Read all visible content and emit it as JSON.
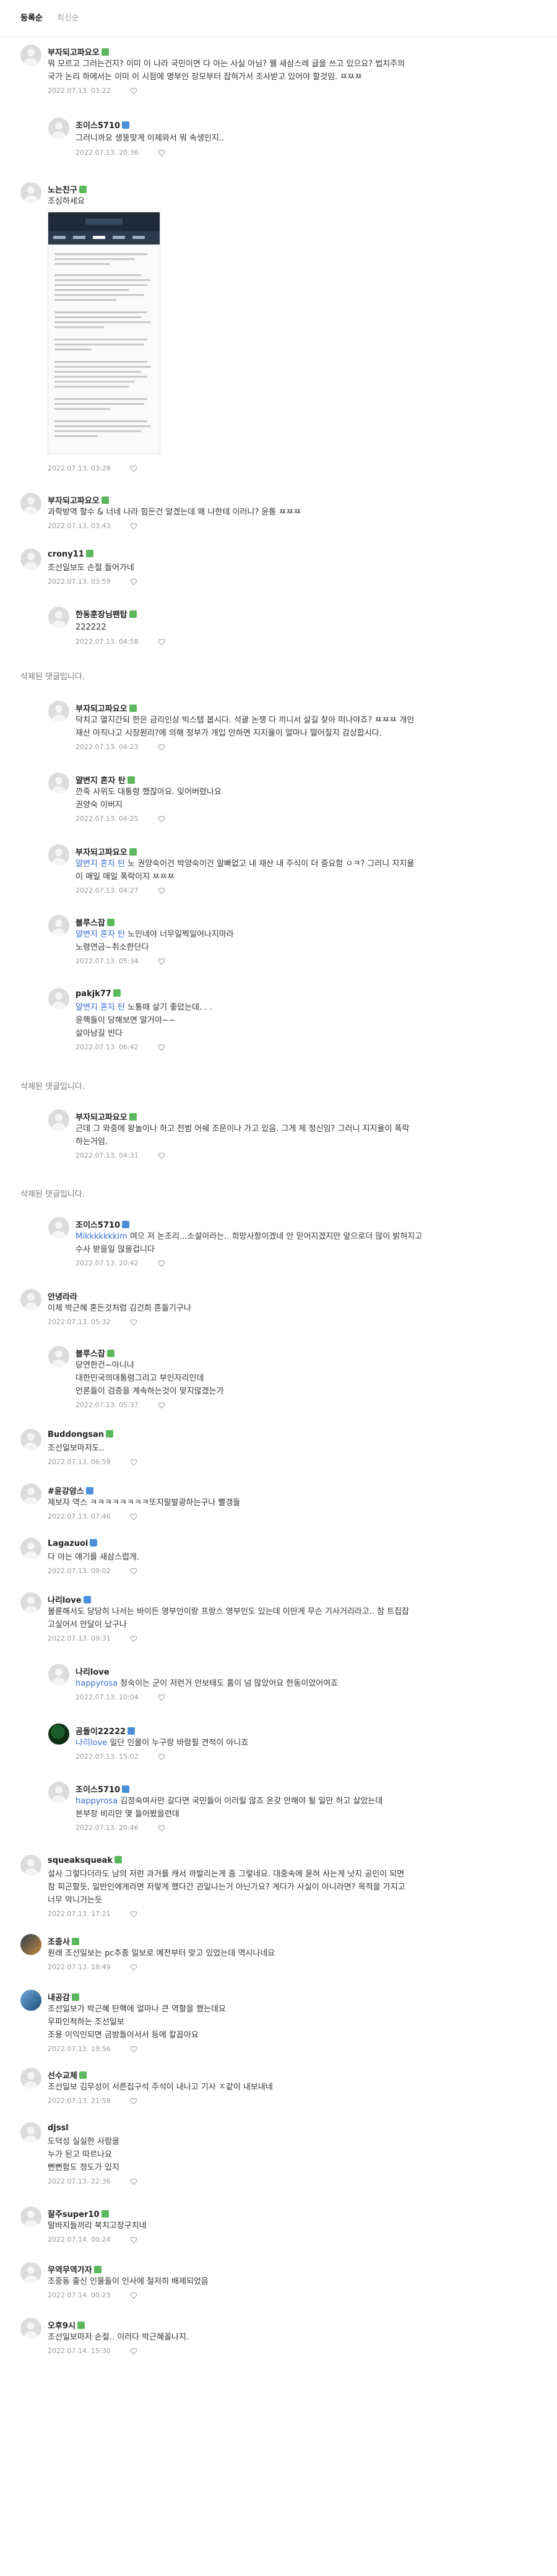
{
  "sort": {
    "active": "등록순",
    "other": "최신순"
  },
  "deleted_text": "삭제된 댓글입니다.",
  "comments": [
    {
      "nick": "부자되고파요오",
      "badge": "g",
      "text": [
        "뭐 모르고 그러는건지? 이미 이 나라 국민이면 다 아는 사실 아님? 웰 새삼스레 글을 쓰고 있으요? 법치주의",
        "국가 논리 하에서는 이미 이 시점에 명부인 장모부터 잡혀가서 조사받고 있어야 할것임. ㅉㅉㅉ"
      ],
      "date": "2022.07.13. 03:22"
    },
    {
      "nick": "조이스5710",
      "badge": "b",
      "text": [
        "그러니까요 생뚱맞게 이제와서 뭐 속생인지.."
      ],
      "date": "2022.07.13. 20:36"
    },
    {
      "nick": "노는친구",
      "badge": "g",
      "text": [
        "조심하세요"
      ],
      "date": "2022.07.13. 03:29"
    },
    {
      "nick": "부자되고파요오",
      "badge": "g",
      "text": [
        "과학방역 할수 & 너네 나라 힘든건 알겠는데 왜 나한테 이러니? 윤통 ㅉㅉㅉ"
      ],
      "date": "2022.07.13. 03:43"
    },
    {
      "nick": "crony11",
      "badge": "g",
      "text": [
        "조선일보도 손절 들어가네"
      ],
      "date": "2022.07.13. 03:59"
    },
    {
      "nick": "한동훈장님팬탑",
      "badge": "g",
      "text": [
        "222222"
      ],
      "date": "2022.07.13. 04:58"
    },
    {
      "nick": "부자되고파요오",
      "badge": "g",
      "text": [
        "닥치고 열지간되 한은 금리인상 빅스텝 봅시다. 석괄 논쟁 다 끼니서 살길 찾아 떠나야죠? ㅉㅉㅉ 개인",
        "재산 아직나고 시장원리?에 의해 정부가 개입 안하면 지지율이 얼마나 떨어질지 감상합시다."
      ],
      "date": "2022.07.13. 04:23"
    },
    {
      "nick": "얄변지 혼자 탄",
      "badge": "g",
      "text": [
        "깐죽 사위도 대통령 했잖아요. 잊어버렸나요",
        "권양숙 이버지"
      ],
      "date": "2022.07.13. 04:25"
    },
    {
      "nick": "부자되고파요오",
      "badge": "g",
      "mention": "얄변지 혼자 탄",
      "text": [
        "노 권양숙이건 박양숙이건 알빠없고 내 재산 내 주식이 더 중요함 ㅇㅋ? 그러니 지지율",
        "이 매일 매일 폭락이지 ㅉㅉㅉ"
      ],
      "date": "2022.07.13. 04:27"
    },
    {
      "nick": "블루스잡",
      "badge": "g",
      "mention": "얄변지 혼자 탄",
      "text": [
        "노인네야 너무일찍일어나지마라",
        "노령연금~취소한단다"
      ],
      "date": "2022.07.13. 05:34"
    },
    {
      "nick": "pakjk77",
      "badge": "g",
      "mention": "얄변지 혼자 탄",
      "text": [
        "노통때 살기 좋았는데. . .",
        "윤핵들이 당해보면 알거야~~",
        "살아남길 빈다"
      ],
      "date": "2022.07.13. 06:42"
    },
    {
      "nick": "부자되고파요오",
      "badge": "g",
      "text": [
        "근데 그 와중에 왕놀이나 하고 전범 어쉐 조문이나 가고 있음. 그게 제 정신임? 그러니 지지율이 폭락",
        "하는거임."
      ],
      "date": "2022.07.13. 04:31"
    },
    {
      "nick": "조이스5710",
      "badge": "b",
      "mention": "Mikkkkkkkim",
      "text": [
        "여으 저 논조리...소설이라는.. 희망사항이겠네 안 믿어지겠지만 앞으로더 많이 밝혀지고",
        "수사 받을일 많을겁니다"
      ],
      "date": "2022.07.13. 20:42"
    },
    {
      "nick": "안녕라라",
      "badge": "",
      "text": [
        "이제 박근혜 혼든것처럼 김건희 흔들기구나"
      ],
      "date": "2022.07.13. 05:32"
    },
    {
      "nick": "블루스잡",
      "badge": "g",
      "text": [
        "당연한건~아니냐",
        "대한민국의대통령그리고 부인자리인데",
        "언론들이 검증을 계속하는것이 맞지않겠는가"
      ],
      "date": "2022.07.13. 05:37"
    },
    {
      "nick": "Buddongsan",
      "badge": "g",
      "text": [
        "조선일보마저도.."
      ],
      "date": "2022.07.13. 06:59"
    },
    {
      "nick": "#윤강암스",
      "badge": "b",
      "text": [
        "제보자 역스 ㅋㅋㅋㅋㅋㅋㅋㅋ또지랄발광하는구나 빨갱들"
      ],
      "date": "2022.07.13. 07:46"
    },
    {
      "nick": "Lagazuoi",
      "badge": "b",
      "text": [
        "다 아는 얘기를 새삼스럽게."
      ],
      "date": "2022.07.13. 09:02"
    },
    {
      "nick": "나리love",
      "badge": "b",
      "text": [
        "불륜해서도 당당히 나서는 바이든 영부인이랑 프랑스 영부인도 있는데 이딴게 무슨 기사거리라고.. 참 트집잡",
        "고싶어서 안달이 났구나"
      ],
      "date": "2022.07.13. 09:31"
    },
    {
      "nick": "나리love",
      "badge": "",
      "mention": "happyrosa",
      "text": [
        "청숙이는 군이 저런거 안보태도 홈이 넘 많았어요 한동이었어여죠"
      ],
      "date": "2022.07.13. 10:04"
    },
    {
      "nick": "곰돌이22222",
      "badge": "b",
      "mention": "나리love",
      "text": [
        "일단 인물이 누구랑 바람필 견적이 아니죠"
      ],
      "date": "2022.07.13. 15:02"
    },
    {
      "nick": "조이스5710",
      "badge": "b",
      "mention": "happyrosa",
      "text": [
        "김정숙여사만 갈다면 국민들이 이러릴 않죠 온갖 안해야 될 일만 하고 살았는데",
        "본부장 비리만 몇 들어봤을련데"
      ],
      "date": "2022.07.13. 20:46"
    },
    {
      "nick": "squeaksqueak",
      "badge": "g",
      "text": [
        "설사 그렇다더라도 남의 저런 과거를 캐서 까발리는게 좀 그렇네요. 대중속에 묻혀 사는게 낫지 공인이 되면",
        "참 피곤할듯, 일반인에게라면 저렇게 했다간 괸일나는거 아닌가요? 게다가 사실이 아니라면? 목적을 가지고",
        "너무 악니거는듯"
      ],
      "date": "2022.07.13. 17:21"
    },
    {
      "nick": "조중사",
      "badge": "g",
      "text": [
        "원래 조선일보는 pc추종 일보로 예전부터 맞고 있었는데 역시나네요"
      ],
      "date": "2022.07.13. 18:49"
    },
    {
      "nick": "내공감",
      "badge": "g",
      "text": [
        "조선일보가 박근혜 탄핵에 얼마나 큰 역할을 했는데요",
        "우파인척하는 조선일보",
        "조용 이익인되면 금방돌아서서 등에 칼꼽아요"
      ],
      "date": "2022.07.13. 19:56"
    },
    {
      "nick": "선수교체",
      "badge": "g",
      "text": [
        "조선일보 김무성이 서른집구석 주석이 내나고 기사 ㅈ같이 내보내네"
      ],
      "date": "2022.07.13. 21:59"
    },
    {
      "nick": "djssl",
      "badge": "",
      "text": [
        "도덕성 실실한 사람을",
        "누가 된고 따르나요",
        "뻔뻔함도 정도가 있지"
      ],
      "date": "2022.07.13. 22:36"
    },
    {
      "nick": "잘주super10",
      "badge": "g",
      "text": [
        "말바지들끼리 북치고장구치네"
      ],
      "date": "2022.07.14. 00:24"
    },
    {
      "nick": "무역무역가자",
      "badge": "g",
      "text": [
        "조중동 출신 인물들이 인사에 철저히 배제되었음"
      ],
      "date": "2022.07.14. 00:23"
    },
    {
      "nick": "오후9시",
      "badge": "g",
      "text": [
        "조선일보마저 손절.. 이러다 박근혜꼴나지."
      ],
      "date": "2022.07.14. 15:30"
    }
  ]
}
